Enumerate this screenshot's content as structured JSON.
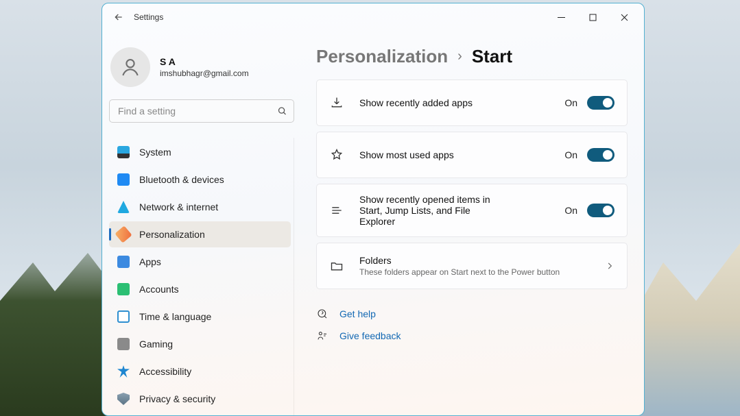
{
  "app": {
    "title": "Settings"
  },
  "profile": {
    "name": "S A",
    "email": "imshubhagr@gmail.com"
  },
  "search": {
    "placeholder": "Find a setting"
  },
  "nav": {
    "items": [
      {
        "label": "System"
      },
      {
        "label": "Bluetooth & devices"
      },
      {
        "label": "Network & internet"
      },
      {
        "label": "Personalization"
      },
      {
        "label": "Apps"
      },
      {
        "label": "Accounts"
      },
      {
        "label": "Time & language"
      },
      {
        "label": "Gaming"
      },
      {
        "label": "Accessibility"
      },
      {
        "label": "Privacy & security"
      }
    ],
    "active_index": 3
  },
  "breadcrumb": {
    "parent": "Personalization",
    "current": "Start"
  },
  "settings": {
    "recently_added": {
      "label": "Show recently added apps",
      "state": "On",
      "on": true
    },
    "most_used": {
      "label": "Show most used apps",
      "state": "On",
      "on": true
    },
    "recent_items": {
      "label": "Show recently opened items in Start, Jump Lists, and File Explorer",
      "state": "On",
      "on": true
    },
    "folders": {
      "label": "Folders",
      "sub": "These folders appear on Start next to the Power button"
    }
  },
  "links": {
    "help": "Get help",
    "feedback": "Give feedback"
  }
}
